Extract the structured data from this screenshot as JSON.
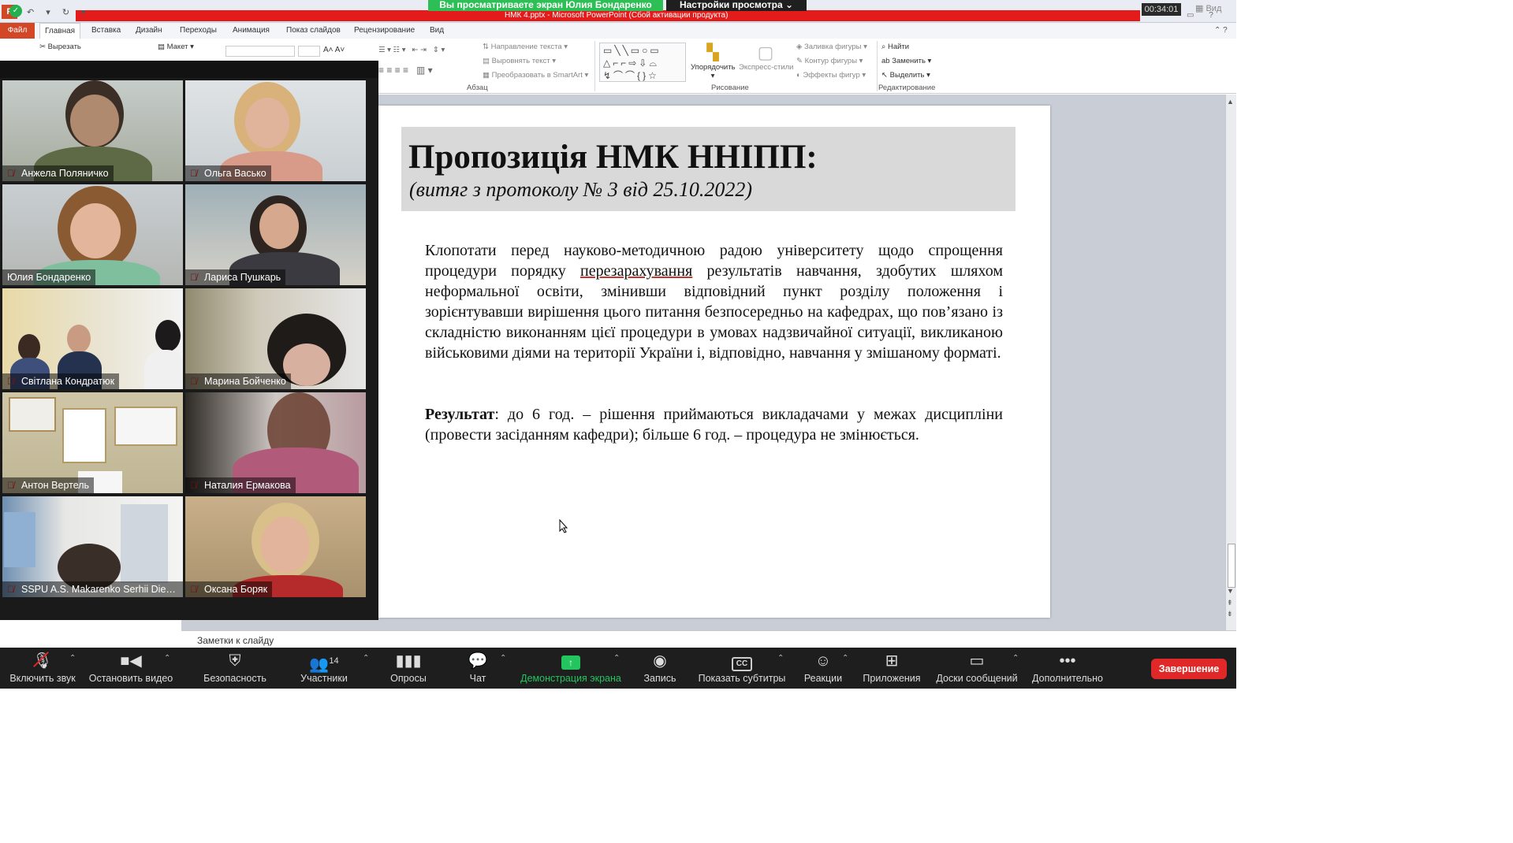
{
  "zoom_banner": {
    "sharing_text": "Вы просматриваете экран Юлия Бондаренко",
    "view_options": "Настройки просмотра ⌄",
    "timer": "00:34:01",
    "view_tag": "Вид"
  },
  "ppt": {
    "window_title": "НМК 4.pptx  -  Microsoft PowerPoint (Сбой активации продукта)",
    "tabs": [
      "Файл",
      "Главная",
      "Вставка",
      "Дизайн",
      "Переходы",
      "Анимация",
      "Показ слайдов",
      "Рецензирование",
      "Вид"
    ],
    "ribbon": {
      "cut": "Вырезать",
      "layout": "Макет",
      "text_direction": "Направление текста",
      "align_text": "Выровнять текст",
      "smartart": "Преобразовать в SmartArt",
      "paragraph_group": "Абзац",
      "arrange": "Упорядочить",
      "quick_styles": "Экспресс-стили",
      "shape_fill": "Заливка фигуры",
      "shape_outline": "Контур фигуры",
      "shape_effects": "Эффекты фигур",
      "drawing_group": "Рисование",
      "find": "Найти",
      "replace": "Заменить",
      "select": "Выделить",
      "editing_group": "Редактирование"
    },
    "notes_placeholder": "Заметки к слайду"
  },
  "slide": {
    "title": "Пропозиція НМК ННІПП:",
    "subtitle": "(витяг з протоколу № 3 від 25.10.2022)",
    "para1_before": "Клопотати перед науково-методичною радою університету щодо спрощення процедури порядку ",
    "para1_underlined": "перезарахування",
    "para1_after": " результатів навчання, здобутих шляхом неформальної освіти, змінивши відповідний пункт розділу положення і зорієнтувавши вирішення цього питання безпосередньо на кафедрах, що пов’язано із складністю виконанням цієї процедури в умовах надзвичайної ситуації, викликаною військовими діями на території України і, відповідно, навчання у змішаному  форматі.",
    "result_label": "Результат",
    "result_text": ": до 6 год. – рішення приймаються викладачами у межах дисципліни (провести засіданням  кафедри); більше 6 год. – процедура не змінюється."
  },
  "participants": [
    {
      "name": "Анжела Поляничко",
      "muted": true
    },
    {
      "name": "Ольга Васько",
      "muted": true
    },
    {
      "name": "Юлия Бондаренко",
      "muted": false
    },
    {
      "name": "Лариса Пушкарь",
      "muted": true
    },
    {
      "name": "Світлана Кондратюк",
      "muted": true
    },
    {
      "name": "Марина Бойченко",
      "muted": true
    },
    {
      "name": "Антон Вертель",
      "muted": true
    },
    {
      "name": "Наталия Ермакова",
      "muted": true
    },
    {
      "name": "SSPU A.S. Makarenko Serhii Dieni...",
      "muted": true
    },
    {
      "name": "Оксана Боряк",
      "muted": true
    }
  ],
  "toolbar": {
    "unmute": "Включить звук",
    "stop_video": "Остановить видео",
    "security": "Безопасность",
    "participants": "Участники",
    "participants_count": "14",
    "polls": "Опросы",
    "chat": "Чат",
    "share_screen": "Демонстрация экрана",
    "record": "Запись",
    "captions": "Показать субтитры",
    "reactions": "Реакции",
    "apps": "Приложения",
    "whiteboards": "Доски сообщений",
    "more": "Дополнительно",
    "end": "Завершение"
  }
}
